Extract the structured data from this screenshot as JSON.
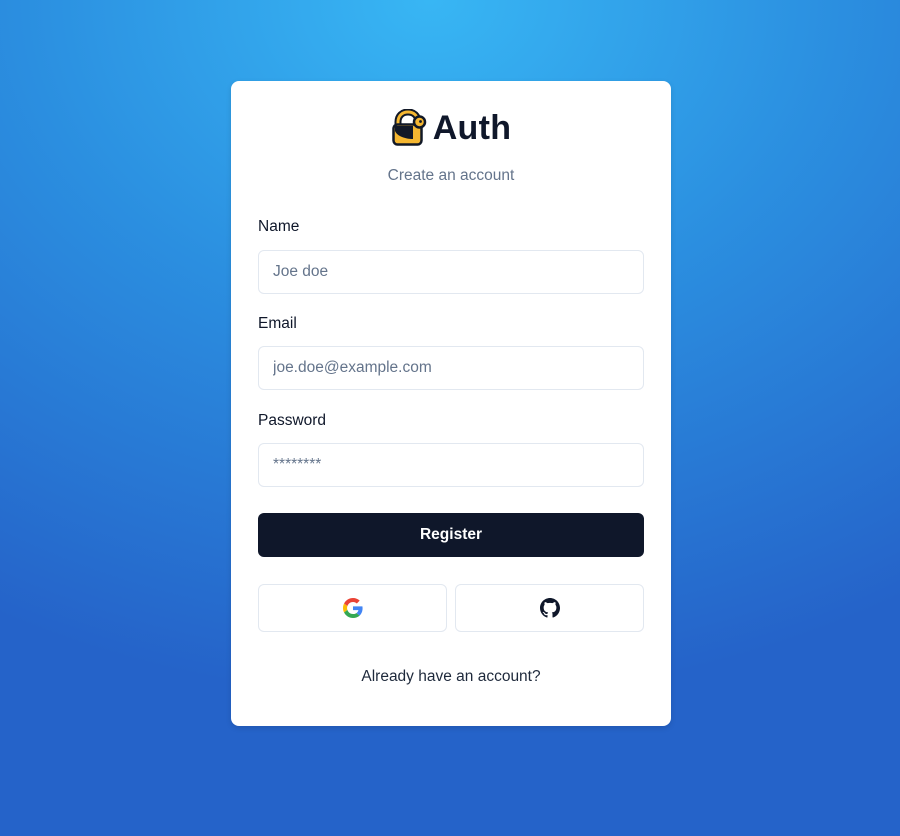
{
  "brand": {
    "name": "Auth",
    "logo_icon": "lock-icon"
  },
  "form": {
    "subtitle": "Create an account",
    "name": {
      "label": "Name",
      "placeholder": "Joe doe",
      "value": ""
    },
    "email": {
      "label": "Email",
      "placeholder": "joe.doe@example.com",
      "value": ""
    },
    "password": {
      "label": "Password",
      "placeholder": "********",
      "value": ""
    },
    "submit_label": "Register"
  },
  "social": {
    "google_icon": "google-icon",
    "github_icon": "github-icon"
  },
  "footer": {
    "login_link": "Already have an account?"
  },
  "colors": {
    "background_top": "#38b6f4",
    "background_bottom": "#2563c9",
    "primary_button": "#0f172a",
    "logo_yellow": "#f5b731"
  }
}
